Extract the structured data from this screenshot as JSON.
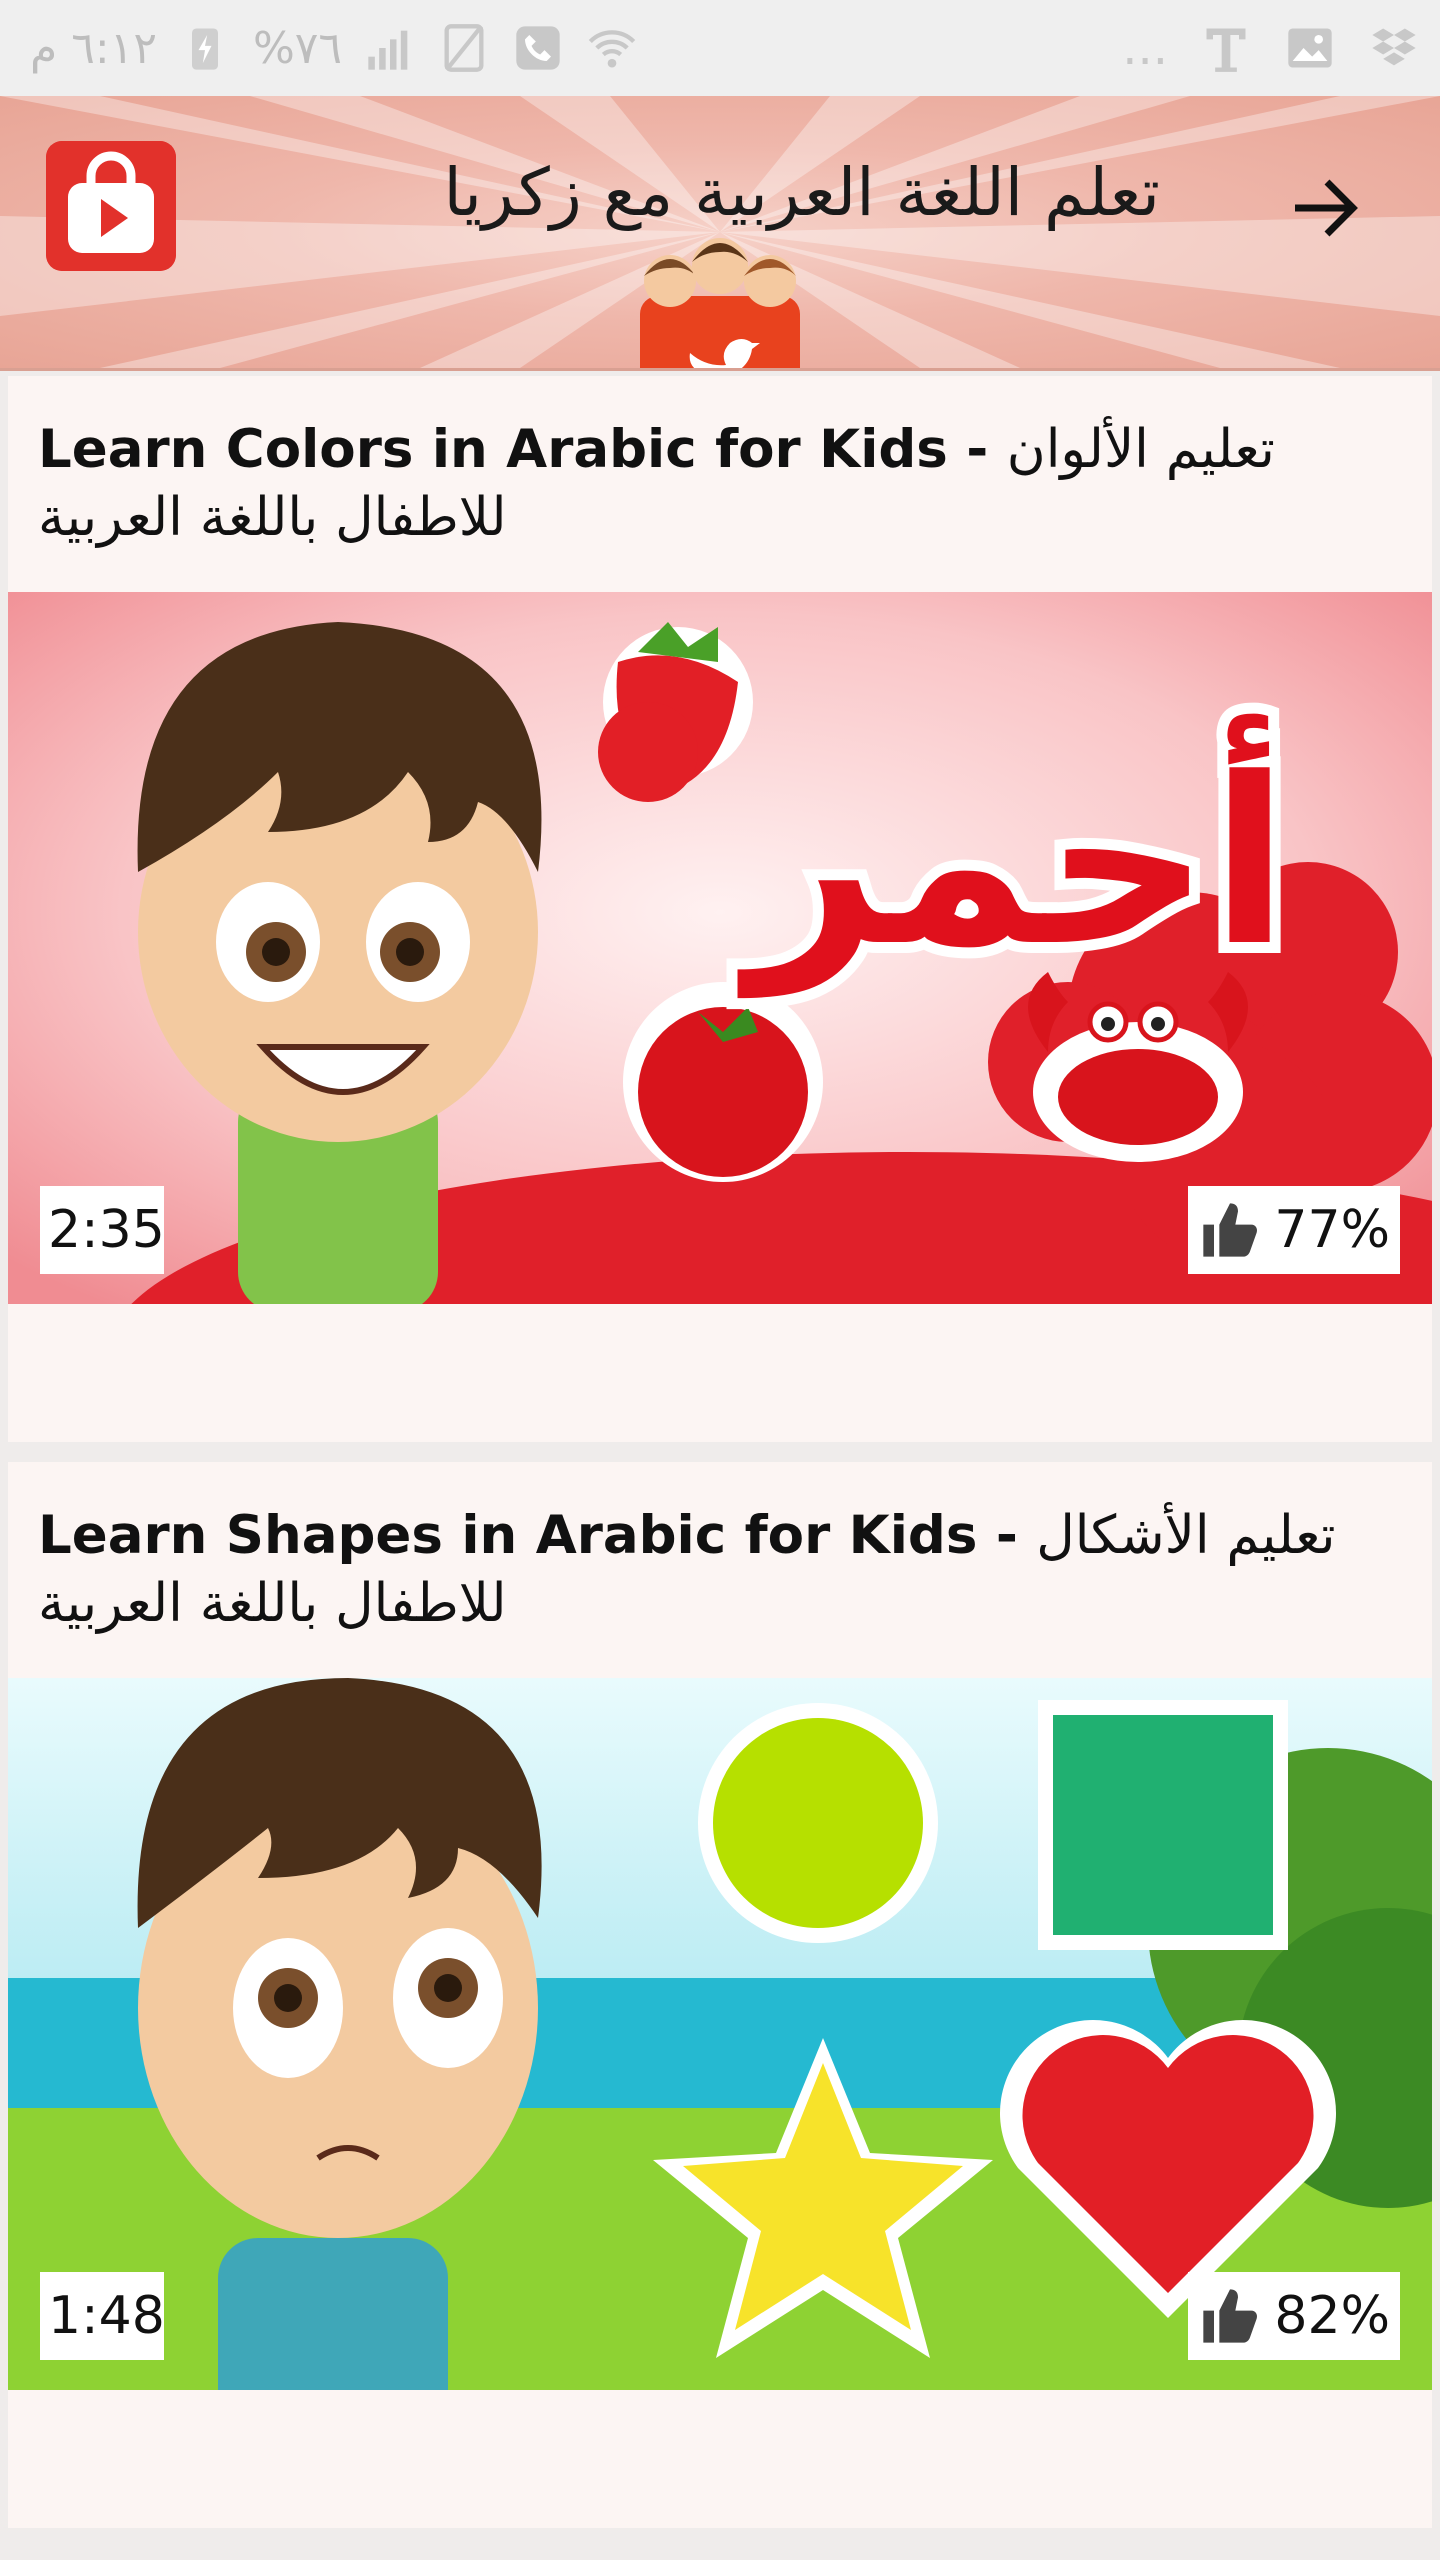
{
  "status_bar": {
    "time": "٦:١٢ م",
    "battery": "%٧٦",
    "more": "..."
  },
  "header": {
    "title": "تعلم اللغة العربية مع زكريا",
    "back_icon": "arrow-right-icon",
    "app_icon": "shopping-bag-play-icon",
    "colors": {
      "accent": "#e2312b",
      "bar": "#efb7ab"
    }
  },
  "videos": [
    {
      "title_en": "Learn Colors in Arabic for Kids - ",
      "title_ar": "تعليم الألوان للاطفال باللغة العربية",
      "thumb_text": "أحمر",
      "duration": "2:35",
      "rating": "77%"
    },
    {
      "title_en": "Learn Shapes in Arabic for Kids - ",
      "title_ar": "تعليم الأشكال للاطفال باللغة العربية",
      "thumb_text": "",
      "duration": "1:48",
      "rating": "82%"
    }
  ]
}
